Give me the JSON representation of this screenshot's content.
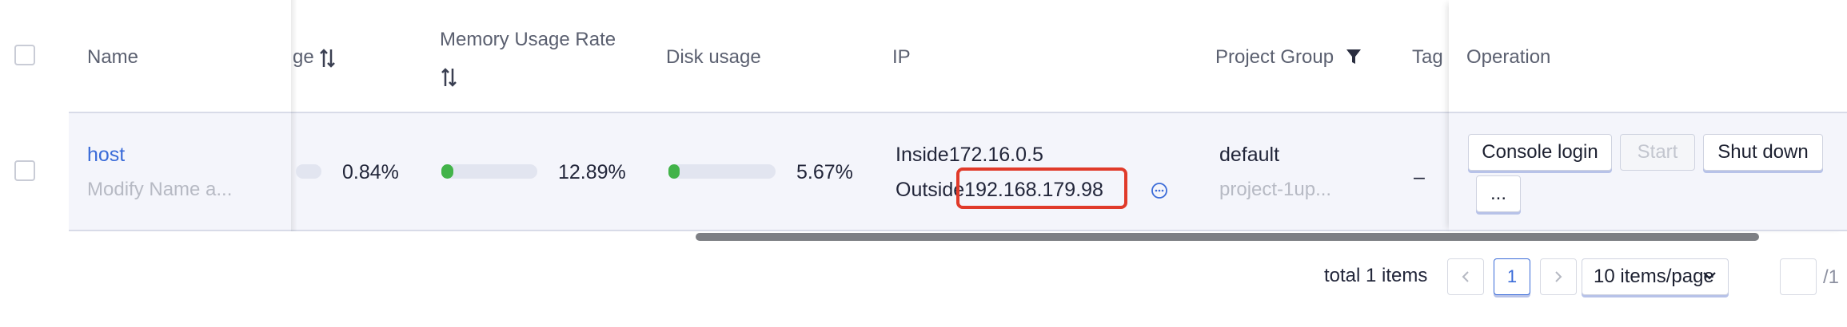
{
  "header": {
    "name": "Name",
    "cpu_partial": "ge",
    "memory": "Memory Usage Rate",
    "disk": "Disk usage",
    "ip": "IP",
    "project_group": "Project Group",
    "tag_partial": "Tag",
    "operation": "Operation"
  },
  "row": {
    "name_link": "host",
    "name_sub": "Modify Name a...",
    "cpu_value": "0.84%",
    "cpu_fraction": 0.0084,
    "memory_value": "12.89%",
    "memory_fraction": 0.1289,
    "disk_value": "5.67%",
    "disk_fraction": 0.0567,
    "ip_inside_label": "Inside",
    "ip_inside": "172.16.0.5",
    "ip_outside_label": "Outside",
    "ip_outside": "192.168.179.98",
    "project": "default",
    "project_sub": "project-1up...",
    "tag": "–"
  },
  "operations": {
    "console_login": "Console login",
    "start": "Start",
    "shut_down": "Shut down",
    "more": "..."
  },
  "pagination": {
    "total": "total 1 items",
    "current_page": "1",
    "page_size": "10 items/page",
    "page_total": "/1"
  },
  "colors": {
    "accent": "#3a6bd8",
    "progress": "#42b349",
    "highlight": "#e03a2a"
  },
  "icons": {
    "sort": "sort-icon",
    "filter": "filter-icon",
    "more": "ellipsis-circle-icon",
    "prev": "chevron-left-icon",
    "next": "chevron-right-icon",
    "dropdown": "chevron-down-icon"
  }
}
